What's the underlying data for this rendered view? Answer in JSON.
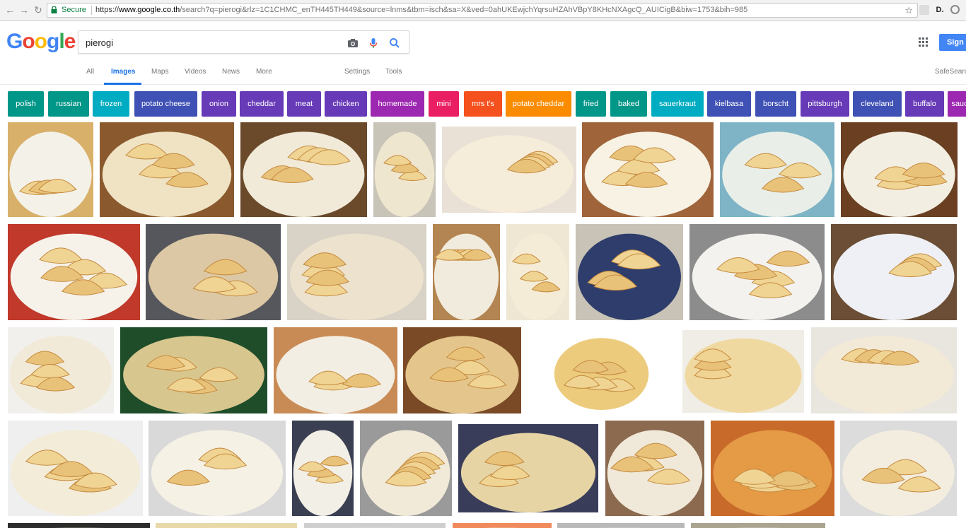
{
  "browser": {
    "secure_label": "Secure",
    "url_scheme": "https://",
    "url_host": "www.google.co.th",
    "url_rest": "/search?q=pierogi&rlz=1C1CHMC_enTH445TH449&source=lnms&tbm=isch&sa=X&ved=0ahUKEwjchYqrsuHZAhVBpY8KHcNXAgcQ_AUICigB&biw=1753&bih=985",
    "secure_color": "#0b8043"
  },
  "header": {
    "logo_text": "Google",
    "search_value": "pierogi",
    "signin_label": "Sign in"
  },
  "tabs": {
    "all": "All",
    "images": "Images",
    "maps": "Maps",
    "videos": "Videos",
    "news": "News",
    "more": "More",
    "settings": "Settings",
    "tools": "Tools",
    "safesearch": "SafeSearch"
  },
  "chips": [
    {
      "label": "polish",
      "color": "#009688"
    },
    {
      "label": "russian",
      "color": "#009688"
    },
    {
      "label": "frozen",
      "color": "#00acc1"
    },
    {
      "label": "potato cheese",
      "color": "#3f51b5"
    },
    {
      "label": "onion",
      "color": "#673ab7"
    },
    {
      "label": "cheddar",
      "color": "#673ab7"
    },
    {
      "label": "meat",
      "color": "#673ab7"
    },
    {
      "label": "chicken",
      "color": "#673ab7"
    },
    {
      "label": "homemade",
      "color": "#9c27b0"
    },
    {
      "label": "mini",
      "color": "#e91e63"
    },
    {
      "label": "mrs t's",
      "color": "#f4511e"
    },
    {
      "label": "potato cheddar",
      "color": "#fb8c00"
    },
    {
      "label": "fried",
      "color": "#009688"
    },
    {
      "label": "baked",
      "color": "#009688"
    },
    {
      "label": "sauerkraut",
      "color": "#00acc1"
    },
    {
      "label": "kielbasa",
      "color": "#3f51b5"
    },
    {
      "label": "borscht",
      "color": "#3f51b5"
    },
    {
      "label": "pittsburgh",
      "color": "#673ab7"
    },
    {
      "label": "cleveland",
      "color": "#3f51b5"
    },
    {
      "label": "buffalo",
      "color": "#673ab7"
    },
    {
      "label": "sauce",
      "color": "#9c27b0"
    }
  ],
  "results": [
    {
      "alt": "pierogi image 1",
      "bg": "#d8b06a",
      "plate": "#f4f1e8"
    },
    {
      "alt": "pierogi image 2",
      "bg": "#8a5a2e",
      "plate": "#efe3c4"
    },
    {
      "alt": "pierogi image 3",
      "bg": "#6b4a2c",
      "plate": "#f1ead8"
    },
    {
      "alt": "pierogi image 4",
      "bg": "#c9c4b8",
      "plate": "#efe6cf"
    },
    {
      "alt": "pierogi image 5",
      "bg": "#e9e0d6",
      "plate": "#f5ecd9"
    },
    {
      "alt": "pierogi image 6",
      "bg": "#a0643a",
      "plate": "#f7f2e4"
    },
    {
      "alt": "pierogi image 7",
      "bg": "#7fb4c6",
      "plate": "#e9efe8"
    },
    {
      "alt": "pierogi image 8",
      "bg": "#6a3f22",
      "plate": "#f3eee2"
    },
    {
      "alt": "pierogi image 9",
      "bg": "#c0392b",
      "plate": "#f6f2ea"
    },
    {
      "alt": "pierogi image 10",
      "bg": "#56575d",
      "plate": "#dcc8a4"
    },
    {
      "alt": "pierogi image 11",
      "bg": "#d9d2c6",
      "plate": "#ece2cd"
    },
    {
      "alt": "pierogi image 12",
      "bg": "#b38552",
      "plate": "#f1ebdd"
    },
    {
      "alt": "pierogi image 13",
      "bg": "#efe6d4",
      "plate": "#f4ecd6"
    },
    {
      "alt": "pierogi image 14",
      "bg": "#c8c3b6",
      "plate": "#2e3d6b"
    },
    {
      "alt": "pierogi image 15",
      "bg": "#8c8c8c",
      "plate": "#f4f2ee"
    },
    {
      "alt": "pierogi image 16",
      "bg": "#6b4e35",
      "plate": "#eef0f5"
    },
    {
      "alt": "pierogi image 17",
      "bg": "#f2f0ec",
      "plate": "#f2ead8"
    },
    {
      "alt": "pierogi image 18",
      "bg": "#1f4d2a",
      "plate": "#d8c68f"
    },
    {
      "alt": "pierogi image 19",
      "bg": "#c98b55",
      "plate": "#f2eee4"
    },
    {
      "alt": "pierogi image 20",
      "bg": "#7a4a26",
      "plate": "#e4c68c"
    },
    {
      "alt": "pierogi image 21",
      "bg": "#ffffff",
      "plate": "#eccb7c"
    },
    {
      "alt": "pierogi image 22",
      "bg": "#f0ede6",
      "plate": "#f0d9a0"
    },
    {
      "alt": "pierogi image 23",
      "bg": "#e9e6df",
      "plate": "#f2ead7"
    },
    {
      "alt": "pierogi image 24",
      "bg": "#efefef",
      "plate": "#f3ecd9"
    },
    {
      "alt": "pierogi image 25",
      "bg": "#d9d9d9",
      "plate": "#f6f1e5"
    },
    {
      "alt": "pierogi image 26",
      "bg": "#3b3f52",
      "plate": "#f2efe7"
    },
    {
      "alt": "pierogi image 27",
      "bg": "#9a9a9a",
      "plate": "#f1ead8"
    },
    {
      "alt": "pierogi image 28",
      "bg": "#3a3d5a",
      "plate": "#e6d4a4"
    },
    {
      "alt": "pierogi image 29",
      "bg": "#8b6a4f",
      "plate": "#f0e8d8"
    },
    {
      "alt": "pierogi image 30",
      "bg": "#c86a2a",
      "plate": "#e59a46"
    },
    {
      "alt": "pierogi image 31",
      "bg": "#dcdcdc",
      "plate": "#f3eddf"
    },
    {
      "alt": "pierogi image 32",
      "bg": "#2c2c2c",
      "plate": "#e2d2b2"
    },
    {
      "alt": "pierogi image 33",
      "bg": "#e8d9a8",
      "plate": "#f1e4c4"
    },
    {
      "alt": "pierogi image 34",
      "bg": "#cfcfcf",
      "plate": "#efe8d8"
    },
    {
      "alt": "pierogi image 35",
      "bg": "#f08a5d",
      "plate": "#f4e6d4"
    },
    {
      "alt": "pierogi image 36",
      "bg": "#b9b9b9",
      "plate": "#eee8dc"
    },
    {
      "alt": "pierogi image 37",
      "bg": "#a9a48f",
      "plate": "#f0ebdf"
    }
  ],
  "icons": {
    "back": "back-arrow-icon",
    "forward": "forward-arrow-icon",
    "reload": "reload-icon",
    "lock": "lock-icon",
    "star": "star-icon",
    "camera": "camera-icon",
    "mic": "microphone-icon",
    "search": "search-icon",
    "apps": "apps-grid-icon"
  }
}
